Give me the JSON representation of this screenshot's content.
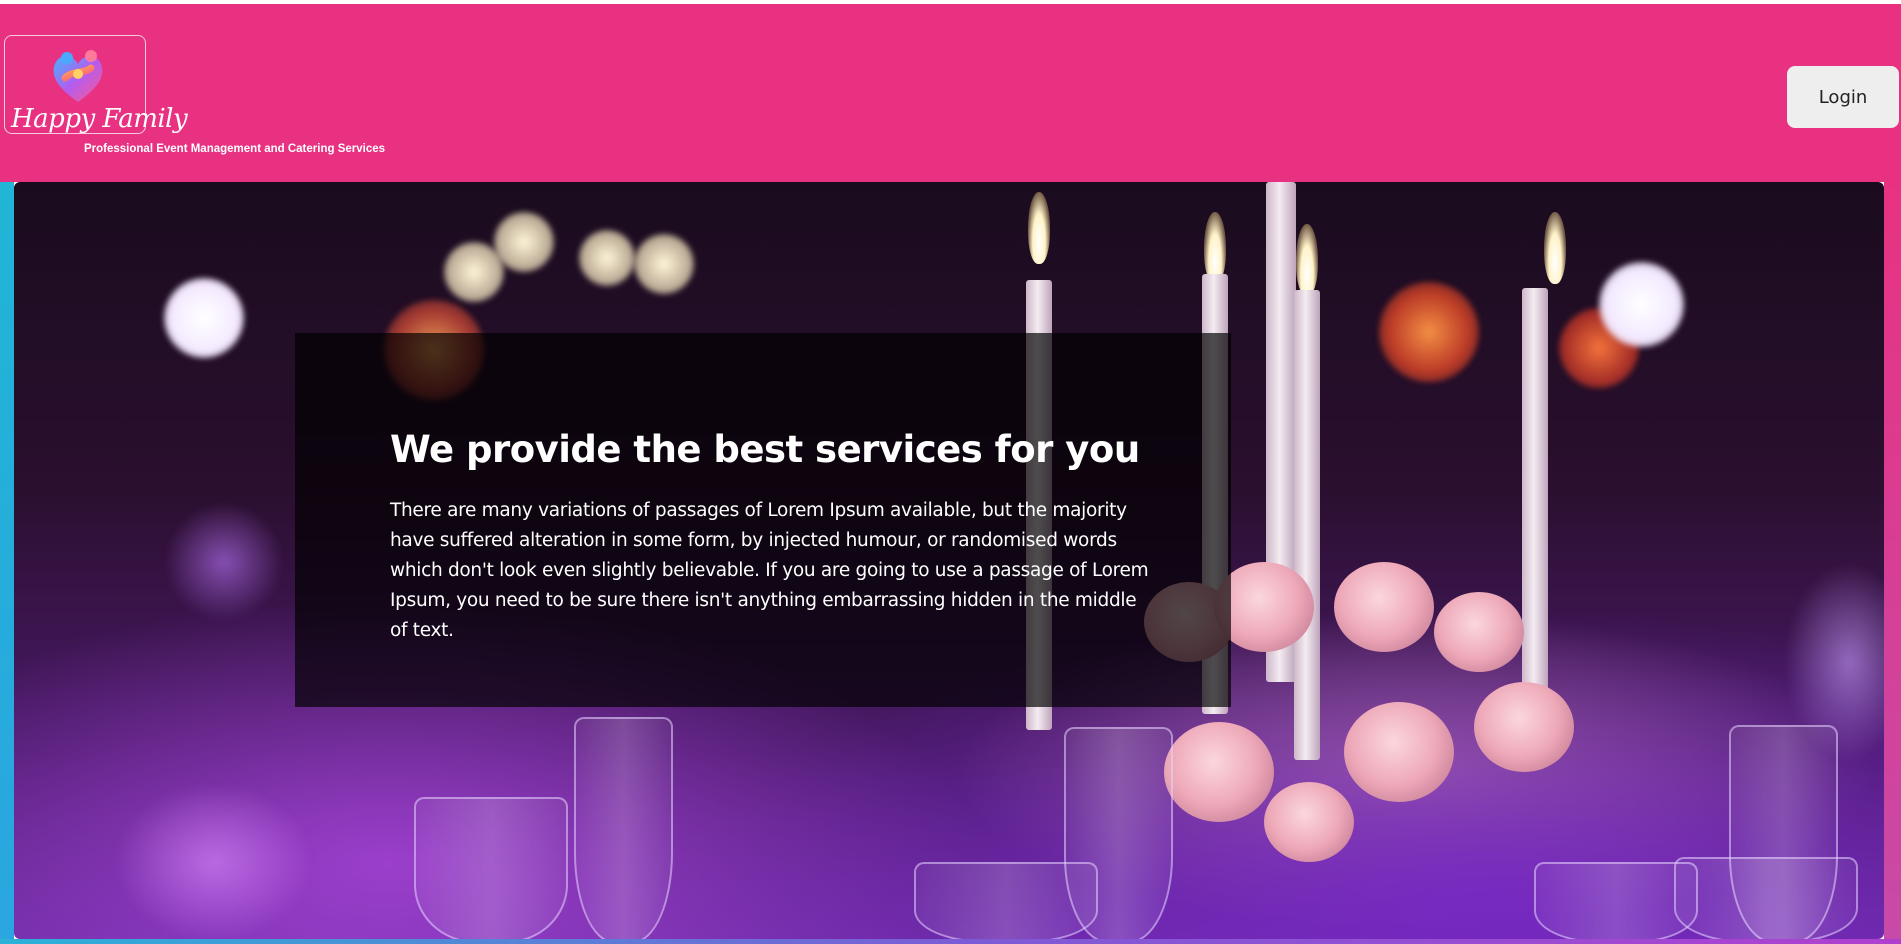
{
  "header": {
    "logo_text": "Happy Family",
    "tagline": "Professional Event Management and Catering Services",
    "login_label": "Login",
    "bg_color": "#e83281"
  },
  "hero": {
    "title": "We provide the best services for you",
    "text": "There are many variations of passages of Lorem Ipsum available, but the majority have suffered alteration in some form, by injected humour, or randomised words which don't look even slightly believable. If you are going to use a passage of Lorem Ipsum, you need to be sure there isn't anything embarrassing hidden in the middle of text."
  }
}
